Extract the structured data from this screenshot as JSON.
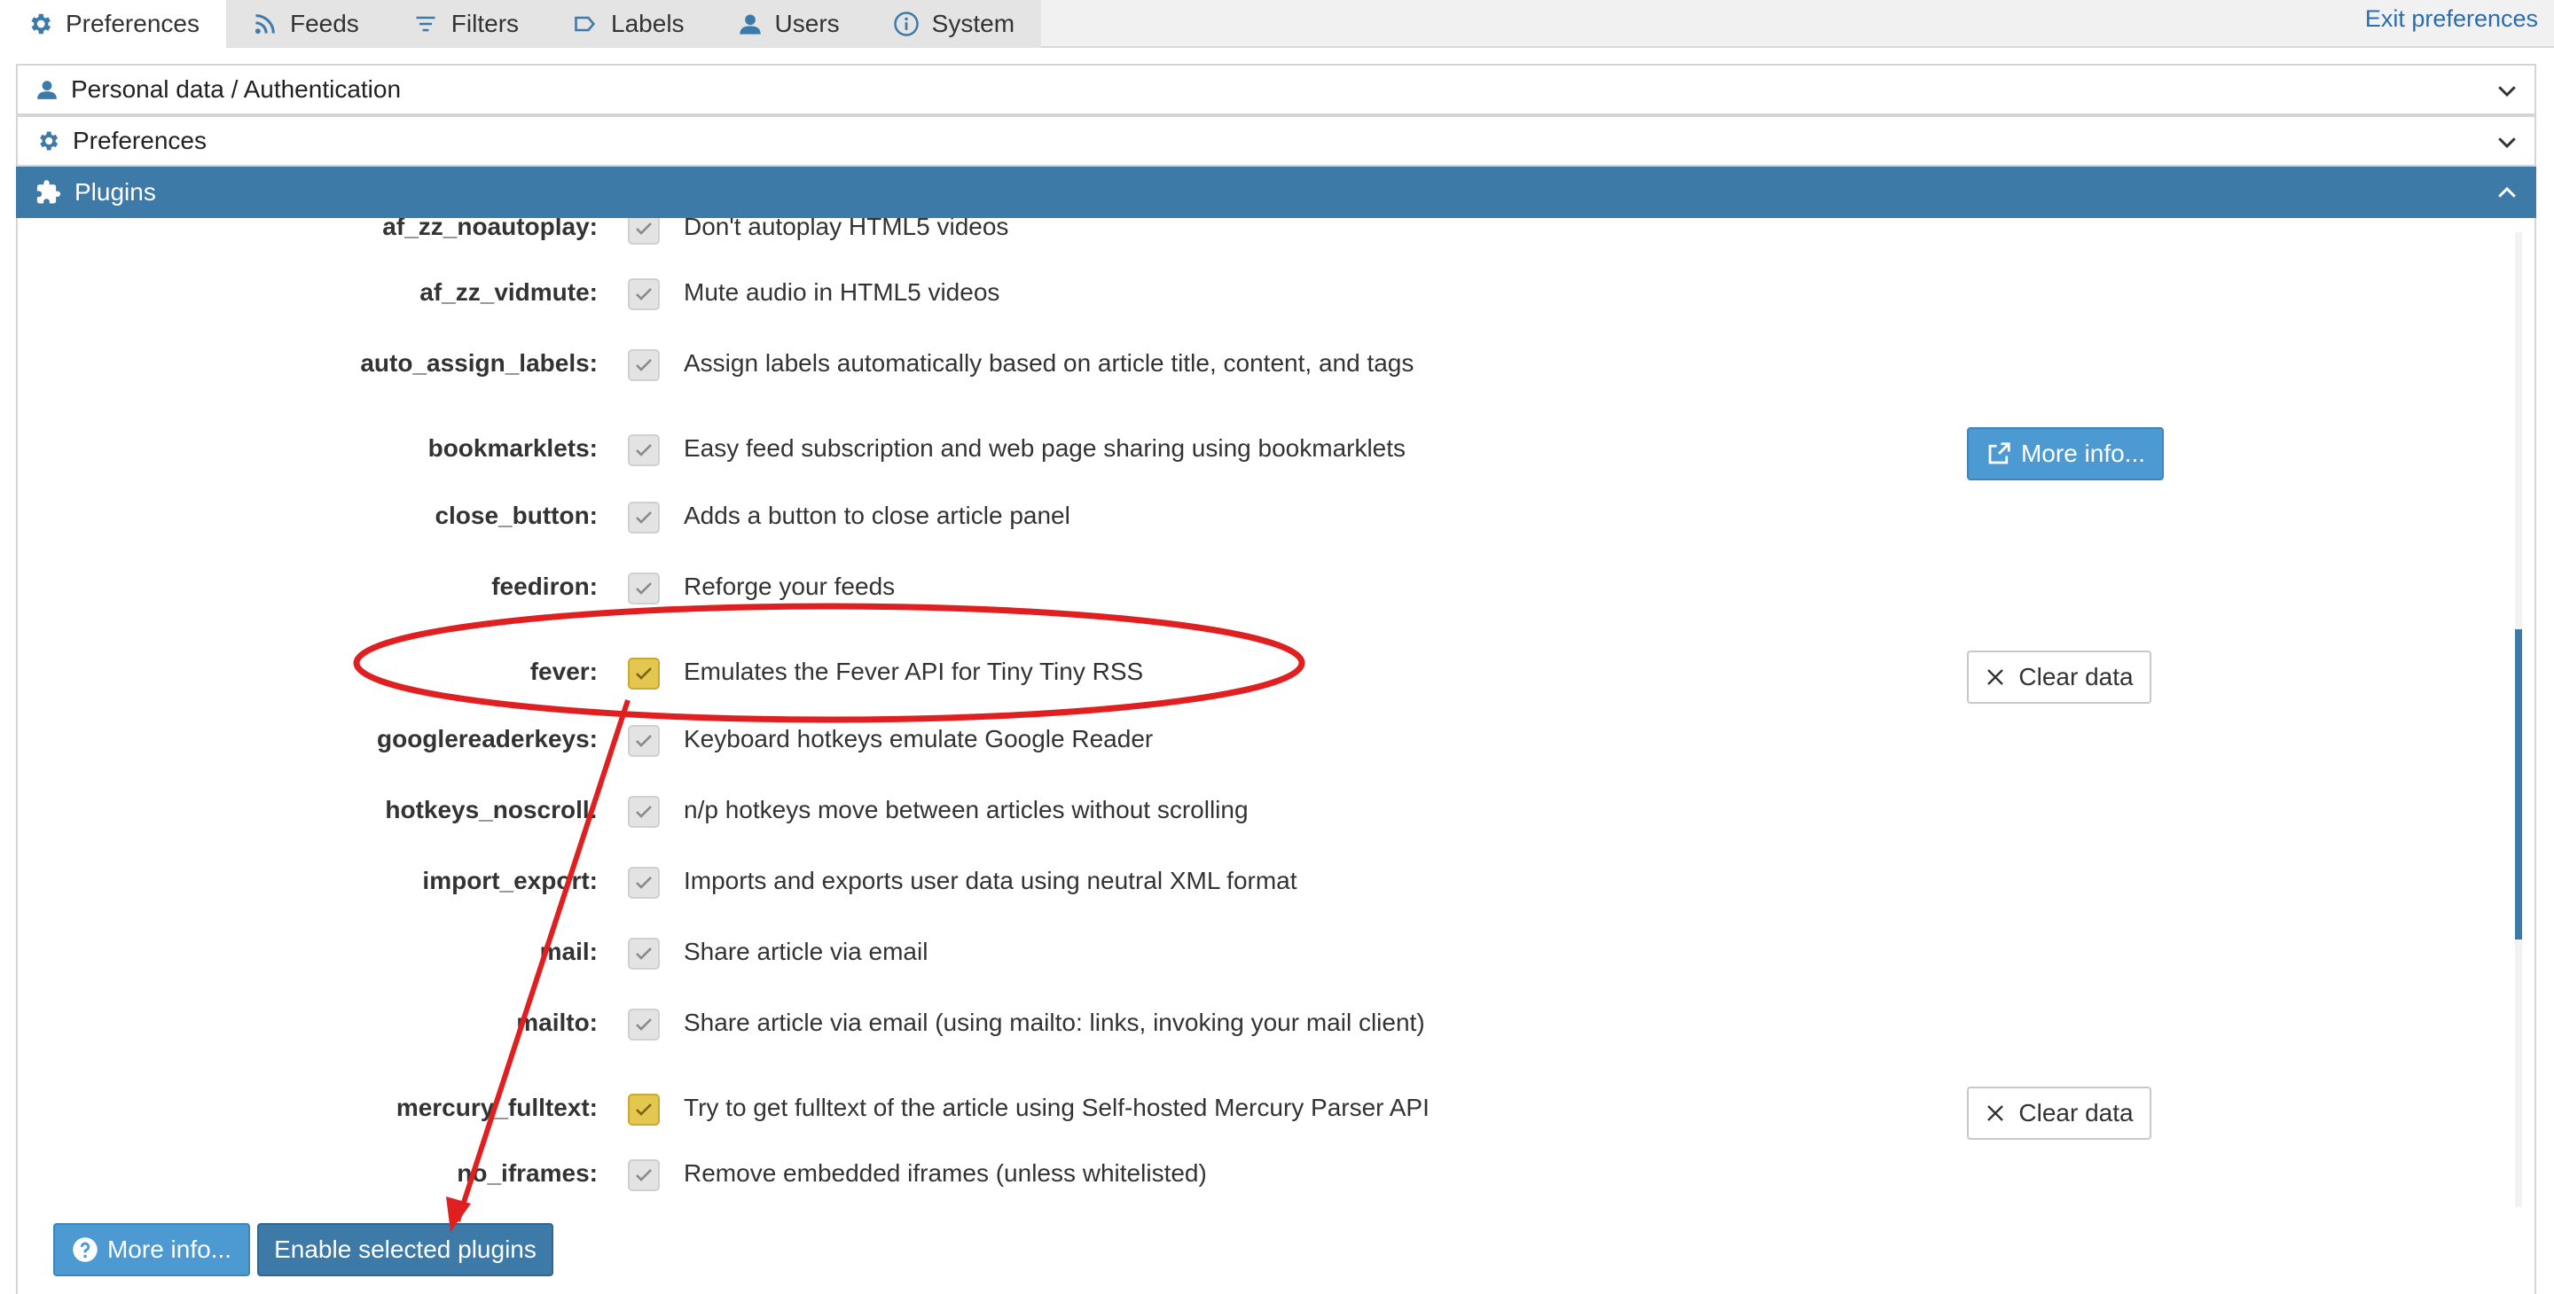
{
  "tabs": [
    {
      "label": "Preferences",
      "icon": "gear-icon"
    },
    {
      "label": "Feeds",
      "icon": "rss-icon"
    },
    {
      "label": "Filters",
      "icon": "filter-icon"
    },
    {
      "label": "Labels",
      "icon": "label-icon"
    },
    {
      "label": "Users",
      "icon": "user-icon"
    },
    {
      "label": "System",
      "icon": "info-icon"
    }
  ],
  "active_tab": "Preferences",
  "exit_label": "Exit preferences",
  "accordion": {
    "personal": "Personal data / Authentication",
    "preferences": "Preferences",
    "plugins": "Plugins"
  },
  "plugins": [
    {
      "name": "af_zz_noautoplay:",
      "desc": "Don't autoplay HTML5 videos",
      "checked": false
    },
    {
      "name": "af_zz_vidmute:",
      "desc": "Mute audio in HTML5 videos",
      "checked": false
    },
    {
      "name": "auto_assign_labels:",
      "desc": "Assign labels automatically based on article title, content, and tags",
      "checked": false
    },
    {
      "name": "bookmarklets:",
      "desc": "Easy feed subscription and web page sharing using bookmarklets",
      "checked": false
    },
    {
      "name": "close_button:",
      "desc": "Adds a button to close article panel",
      "checked": false
    },
    {
      "name": "feediron:",
      "desc": "Reforge your feeds",
      "checked": false
    },
    {
      "name": "fever:",
      "desc": "Emulates the Fever API for Tiny Tiny RSS",
      "checked": true
    },
    {
      "name": "googlereaderkeys:",
      "desc": "Keyboard hotkeys emulate Google Reader",
      "checked": false
    },
    {
      "name": "hotkeys_noscroll:",
      "desc": "n/p hotkeys move between articles without scrolling",
      "checked": false
    },
    {
      "name": "import_export:",
      "desc": "Imports and exports user data using neutral XML format",
      "checked": false
    },
    {
      "name": "mail:",
      "desc": "Share article via email",
      "checked": false
    },
    {
      "name": "mailto:",
      "desc": "Share article via email (using mailto: links, invoking your mail client)",
      "checked": false
    },
    {
      "name": "mercury_fulltext:",
      "desc": "Try to get fulltext of the article using Self-hosted Mercury Parser API",
      "checked": true
    },
    {
      "name": "no_iframes:",
      "desc": "Remove embedded iframes (unless whitelisted)",
      "checked": false
    }
  ],
  "buttons": {
    "more_info": "More info...",
    "clear_data": "Clear data",
    "enable_selected": "Enable selected plugins"
  },
  "colors": {
    "accent": "#3e7aa8",
    "button_light": "#4d9ad3",
    "checked": "#e4c74e",
    "annotation": "#e02020"
  }
}
